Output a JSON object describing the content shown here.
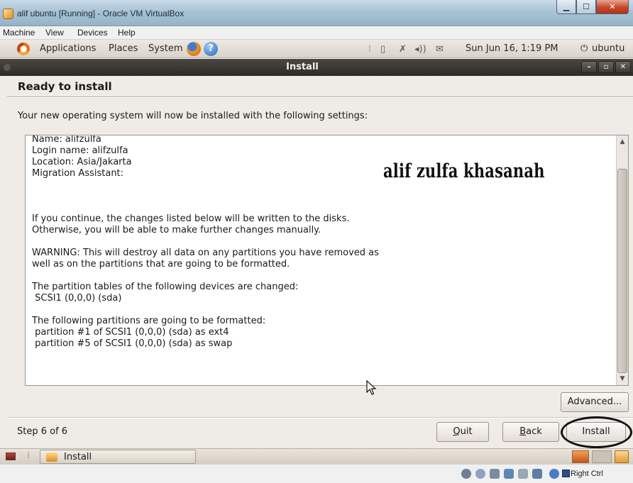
{
  "host": {
    "window_title": "alif ubuntu [Running] - Oracle VM VirtualBox",
    "menu": [
      "Machine",
      "View",
      "Devices",
      "Help"
    ],
    "host_key_label": "Right Ctrl"
  },
  "gnome_panel": {
    "menus": [
      "Applications",
      "Places",
      "System"
    ],
    "clock": "Sun Jun 16,  1:19 PM",
    "user": "ubuntu",
    "power_glyph": "⏻"
  },
  "install_window": {
    "title": "Install",
    "heading": "Ready to install",
    "intro": "Your new operating system will now be installed with the following settings:",
    "summary_lines": [
      "Name: alifzulfa",
      "Login name: alifzulfa",
      "Location: Asia/Jakarta",
      "Migration Assistant:",
      "",
      "",
      "",
      "If you continue, the changes listed below will be written to the disks.",
      "Otherwise, you will be able to make further changes manually.",
      "",
      "WARNING: This will destroy all data on any partitions you have removed as",
      "well as on the partitions that are going to be formatted.",
      "",
      "The partition tables of the following devices are changed:",
      " SCSI1 (0,0,0) (sda)",
      "",
      "The following partitions are going to be formatted:",
      " partition #1 of SCSI1 (0,0,0) (sda) as ext4",
      " partition #5 of SCSI1 (0,0,0) (sda) as swap"
    ],
    "watermark": "alif zulfa khasanah",
    "advanced_label": "Advanced...",
    "step_label": "Step 6 of 6",
    "quit_label": "Quit",
    "back_label": "Back",
    "install_label": "Install"
  },
  "taskbar": {
    "task_label": "Install"
  },
  "colors": {
    "dialog_bg": "#efebe7",
    "titlebar_dark": "#3a3631",
    "highlight_ring": "#111111"
  }
}
